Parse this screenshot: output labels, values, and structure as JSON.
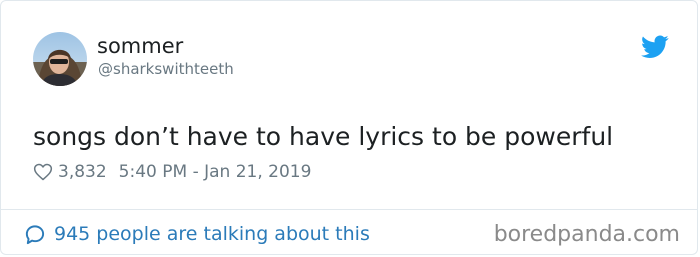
{
  "author": {
    "display_name": "sommer",
    "handle": "@sharkswithteeth"
  },
  "tweet": {
    "text": "songs don’t have to have lyrics to be powerful",
    "likes": "3,832",
    "timestamp": "5:40 PM - Jan 21, 2019"
  },
  "footer": {
    "talking_label": "945 people are talking about this",
    "watermark": "boredpanda.com"
  },
  "icons": {
    "brand": "twitter-bird-icon",
    "like": "heart-icon",
    "reply": "speech-bubble-icon"
  },
  "colors": {
    "twitter_blue": "#1da1f2",
    "link_blue": "#2b7bb9",
    "text": "#1c2022",
    "muted": "#697882",
    "border": "#e1e8ed"
  }
}
